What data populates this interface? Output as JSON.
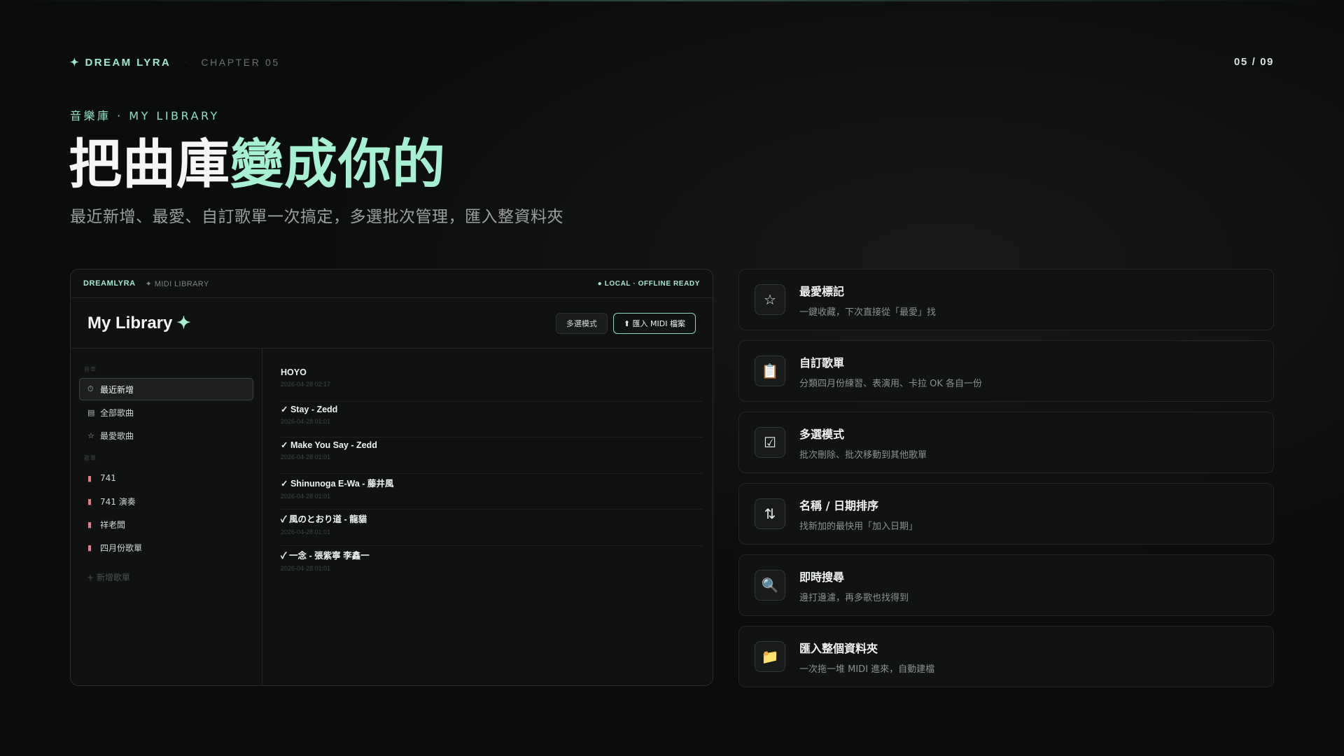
{
  "header": {
    "brand": "✦ DREAM LYRA",
    "chapter": "CHAPTER 05",
    "pager": "05 / 09"
  },
  "hero": {
    "eyebrow": "音樂庫 · MY LIBRARY",
    "title_part1": "把曲庫",
    "title_part2": "變成你的",
    "subtitle": "最近新增、最愛、自訂歌單一次搞定，多選批次管理，匯入整資料夾"
  },
  "app": {
    "brand": "DREAMLYRA",
    "crumb": "✦ MIDI LIBRARY",
    "status": "● LOCAL · OFFLINE READY",
    "title": "My Library",
    "title_spark": "✦",
    "multi_button": "多選模式",
    "import_button": "⬆ 匯入 MIDI 檔案",
    "nav_section_label": "音樂",
    "nav": [
      {
        "icon": "⏱",
        "icon_name": "clock-icon",
        "label": "最近新增"
      },
      {
        "icon": "▤",
        "icon_name": "list-icon",
        "label": "全部歌曲"
      },
      {
        "icon": "☆",
        "icon_name": "star-icon",
        "label": "最愛歌曲"
      }
    ],
    "playlist_section_label": "歌單",
    "playlists": [
      {
        "icon": "▮",
        "icon_name": "clipboard-icon",
        "label": "741"
      },
      {
        "icon": "▮",
        "icon_name": "clipboard-icon",
        "label": "741 演奏"
      },
      {
        "icon": "▮",
        "icon_name": "clipboard-icon",
        "label": "祥老闆"
      },
      {
        "icon": "▮",
        "icon_name": "clipboard-icon",
        "label": "四月份歌單"
      }
    ],
    "add_playlist": "+ 新增歌單",
    "songs": [
      {
        "name": "HOYO",
        "date": "2026-04-28 02:17"
      },
      {
        "name": "✓ Stay - Zedd",
        "date": "2026-04-28 01:01"
      },
      {
        "name": "✓ Make You Say - Zedd",
        "date": "2026-04-28 01:01"
      },
      {
        "name": "✓ Shinunoga E-Wa - 藤井風",
        "date": "2026-04-28 01:01"
      },
      {
        "name": "✓ 風のとおり道 - 龍貓",
        "date": "2026-04-28 01:01"
      },
      {
        "name": "✓ 一念 - 張紫寧 李鑫一",
        "date": "2026-04-28 01:01"
      }
    ]
  },
  "features": [
    {
      "icon": "☆",
      "icon_name": "star-icon",
      "title": "最愛標記",
      "desc": "一鍵收藏，下次直接從「最愛」找"
    },
    {
      "icon": "📋",
      "icon_name": "clipboard-icon",
      "title": "自訂歌單",
      "desc": "分類四月份練習、表演用、卡拉 OK 各自一份"
    },
    {
      "icon": "☑",
      "icon_name": "checkbox-icon",
      "title": "多選模式",
      "desc": "批次刪除、批次移動到其他歌單"
    },
    {
      "icon": "⇅",
      "icon_name": "sort-icon",
      "title": "名稱 / 日期排序",
      "desc": "找新加的最快用「加入日期」"
    },
    {
      "icon": "🔍",
      "icon_name": "search-icon",
      "title": "即時搜尋",
      "desc": "邊打邊濾，再多歌也找得到"
    },
    {
      "icon": "📁",
      "icon_name": "folder-icon",
      "title": "匯入整個資料夾",
      "desc": "一次拖一堆 MIDI 進來，自動建檔"
    }
  ],
  "colors": {
    "accent": "#a6f0d4",
    "background": "#0b0c0c"
  }
}
